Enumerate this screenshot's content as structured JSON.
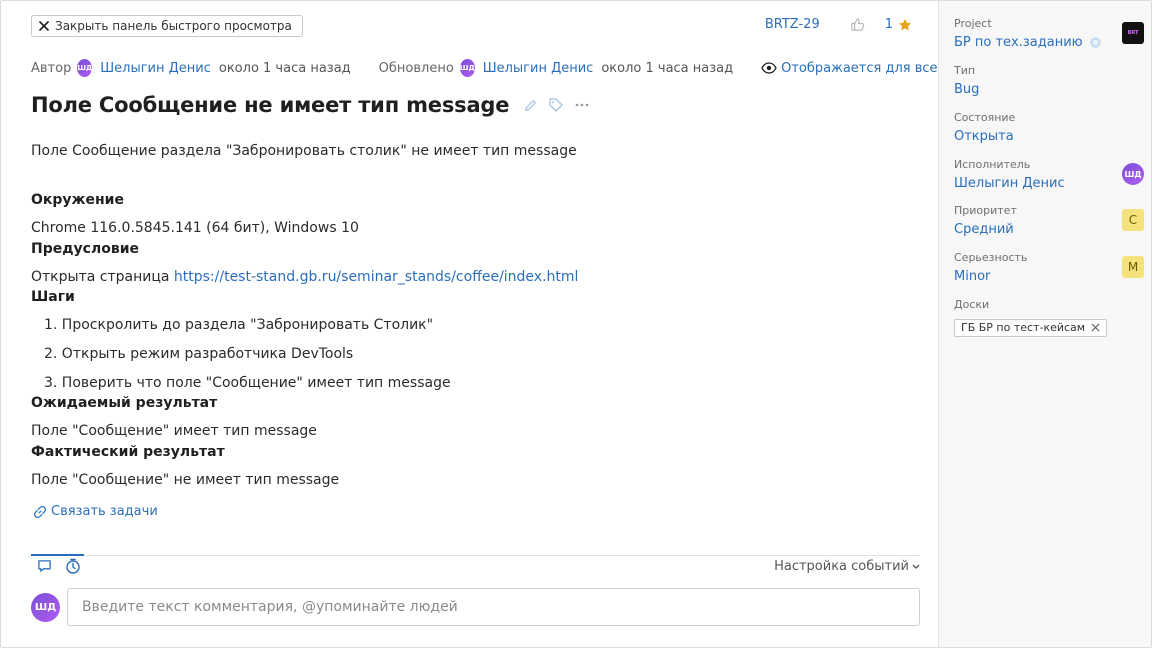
{
  "header": {
    "close_panel_label": "Закрыть панель быстрого просмотра",
    "issue_id": "BRTZ-29",
    "votes": "1",
    "colors": {
      "link": "#2a6ebb",
      "star": "#e8a317"
    }
  },
  "meta": {
    "author_label": "Автор",
    "author_initials": "ШД",
    "author_name": "Шелыгин Денис",
    "author_time": "около 1 часа назад",
    "updated_label": "Обновлено",
    "updated_initials": "ШД",
    "updated_name": "Шелыгин Денис",
    "updated_time": "около 1 часа назад",
    "visibility": "Отображается для всех..."
  },
  "issue": {
    "title": "Поле Сообщение не имеет тип message",
    "summary": "Поле Сообщение раздела \"Забронировать столик\" не имеет тип message",
    "environment_heading": "Окружение",
    "environment": "Chrome 116.0.5845.141 (64 бит), Windows 10",
    "precondition_heading": "Предусловие",
    "precondition_text": "Открыта страница ",
    "precondition_link": "https://test-stand.gb.ru/seminar_stands/coffee/index.html",
    "steps_heading": "Шаги",
    "steps": [
      "1. Проскролить до раздела \"Забронировать Столик\"",
      "2. Открыть режим разработчика DevTools",
      "3. Поверить что поле \"Сообщение\" имеет тип message"
    ],
    "expected_heading": "Ожидаемый результат",
    "expected": "Поле \"Сообщение\" имеет тип message",
    "actual_heading": "Фактический результат",
    "actual": "Поле \"Сообщение\" не имеет тип message",
    "relate_link": "Связать задачи"
  },
  "activity": {
    "events_settings": "Настройка событий",
    "comment_initials": "ШД",
    "comment_placeholder": "Введите текст комментария, @упоминайте людей"
  },
  "sidebar": {
    "project_label": "Project",
    "project_value": "БР по тех.заданию",
    "project_badge": "BRT",
    "type_label": "Тип",
    "type_value": "Bug",
    "state_label": "Состояние",
    "state_value": "Открыта",
    "assignee_label": "Исполнитель",
    "assignee_value": "Шелыгин Денис",
    "assignee_initials": "ШД",
    "priority_label": "Приоритет",
    "priority_value": "Средний",
    "priority_badge": "С",
    "severity_label": "Серьезность",
    "severity_value": "Minor",
    "severity_badge": "M",
    "boards_label": "Доски",
    "board_tag": "ГБ БР по тест-кейсам"
  }
}
